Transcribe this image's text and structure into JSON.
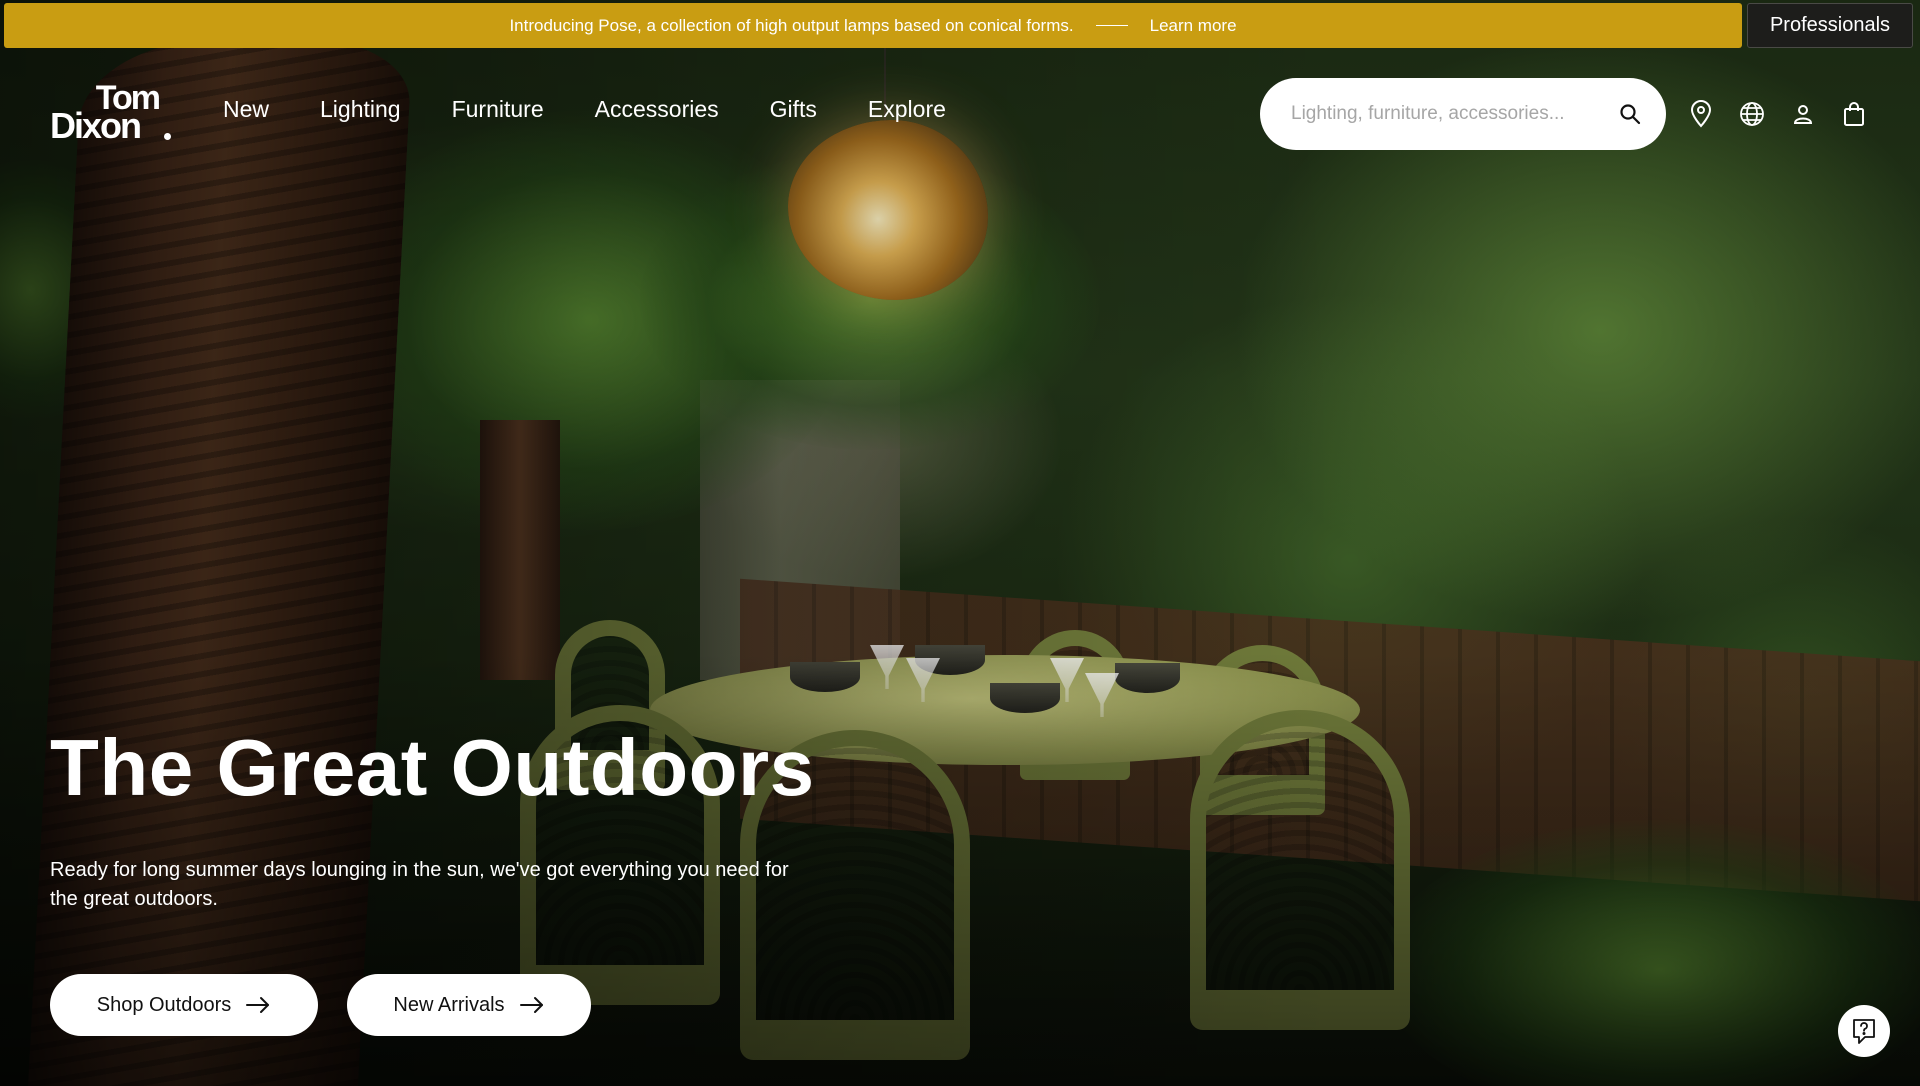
{
  "announcement": {
    "text": "Introducing Pose, a collection of high output lamps based on conical forms.",
    "link_label": "Learn more"
  },
  "professionals_label": "Professionals",
  "logo": {
    "line1": "Tom",
    "line2": "Dixon"
  },
  "nav": {
    "items": [
      {
        "label": "New"
      },
      {
        "label": "Lighting"
      },
      {
        "label": "Furniture"
      },
      {
        "label": "Accessories"
      },
      {
        "label": "Gifts"
      },
      {
        "label": "Explore"
      }
    ]
  },
  "search": {
    "placeholder": "Lighting, furniture, accessories...",
    "icon": "search-icon"
  },
  "header_icons": [
    "location-pin-icon",
    "globe-icon",
    "user-icon",
    "shopping-bag-icon"
  ],
  "hero": {
    "title": "The Great Outdoors",
    "subtitle": "Ready for long summer days lounging in the sun, we've got everything you need for the great outdoors.",
    "buttons": [
      {
        "label": "Shop Outdoors",
        "icon": "arrow-right-icon"
      },
      {
        "label": "New Arrivals",
        "icon": "arrow-right-icon"
      }
    ]
  },
  "help_icon": "help-chat-icon",
  "colors": {
    "announcement_bg": "#c99d12",
    "professionals_bg": "#1d1d1b",
    "text_light": "#ffffff",
    "button_bg": "#ffffff"
  }
}
